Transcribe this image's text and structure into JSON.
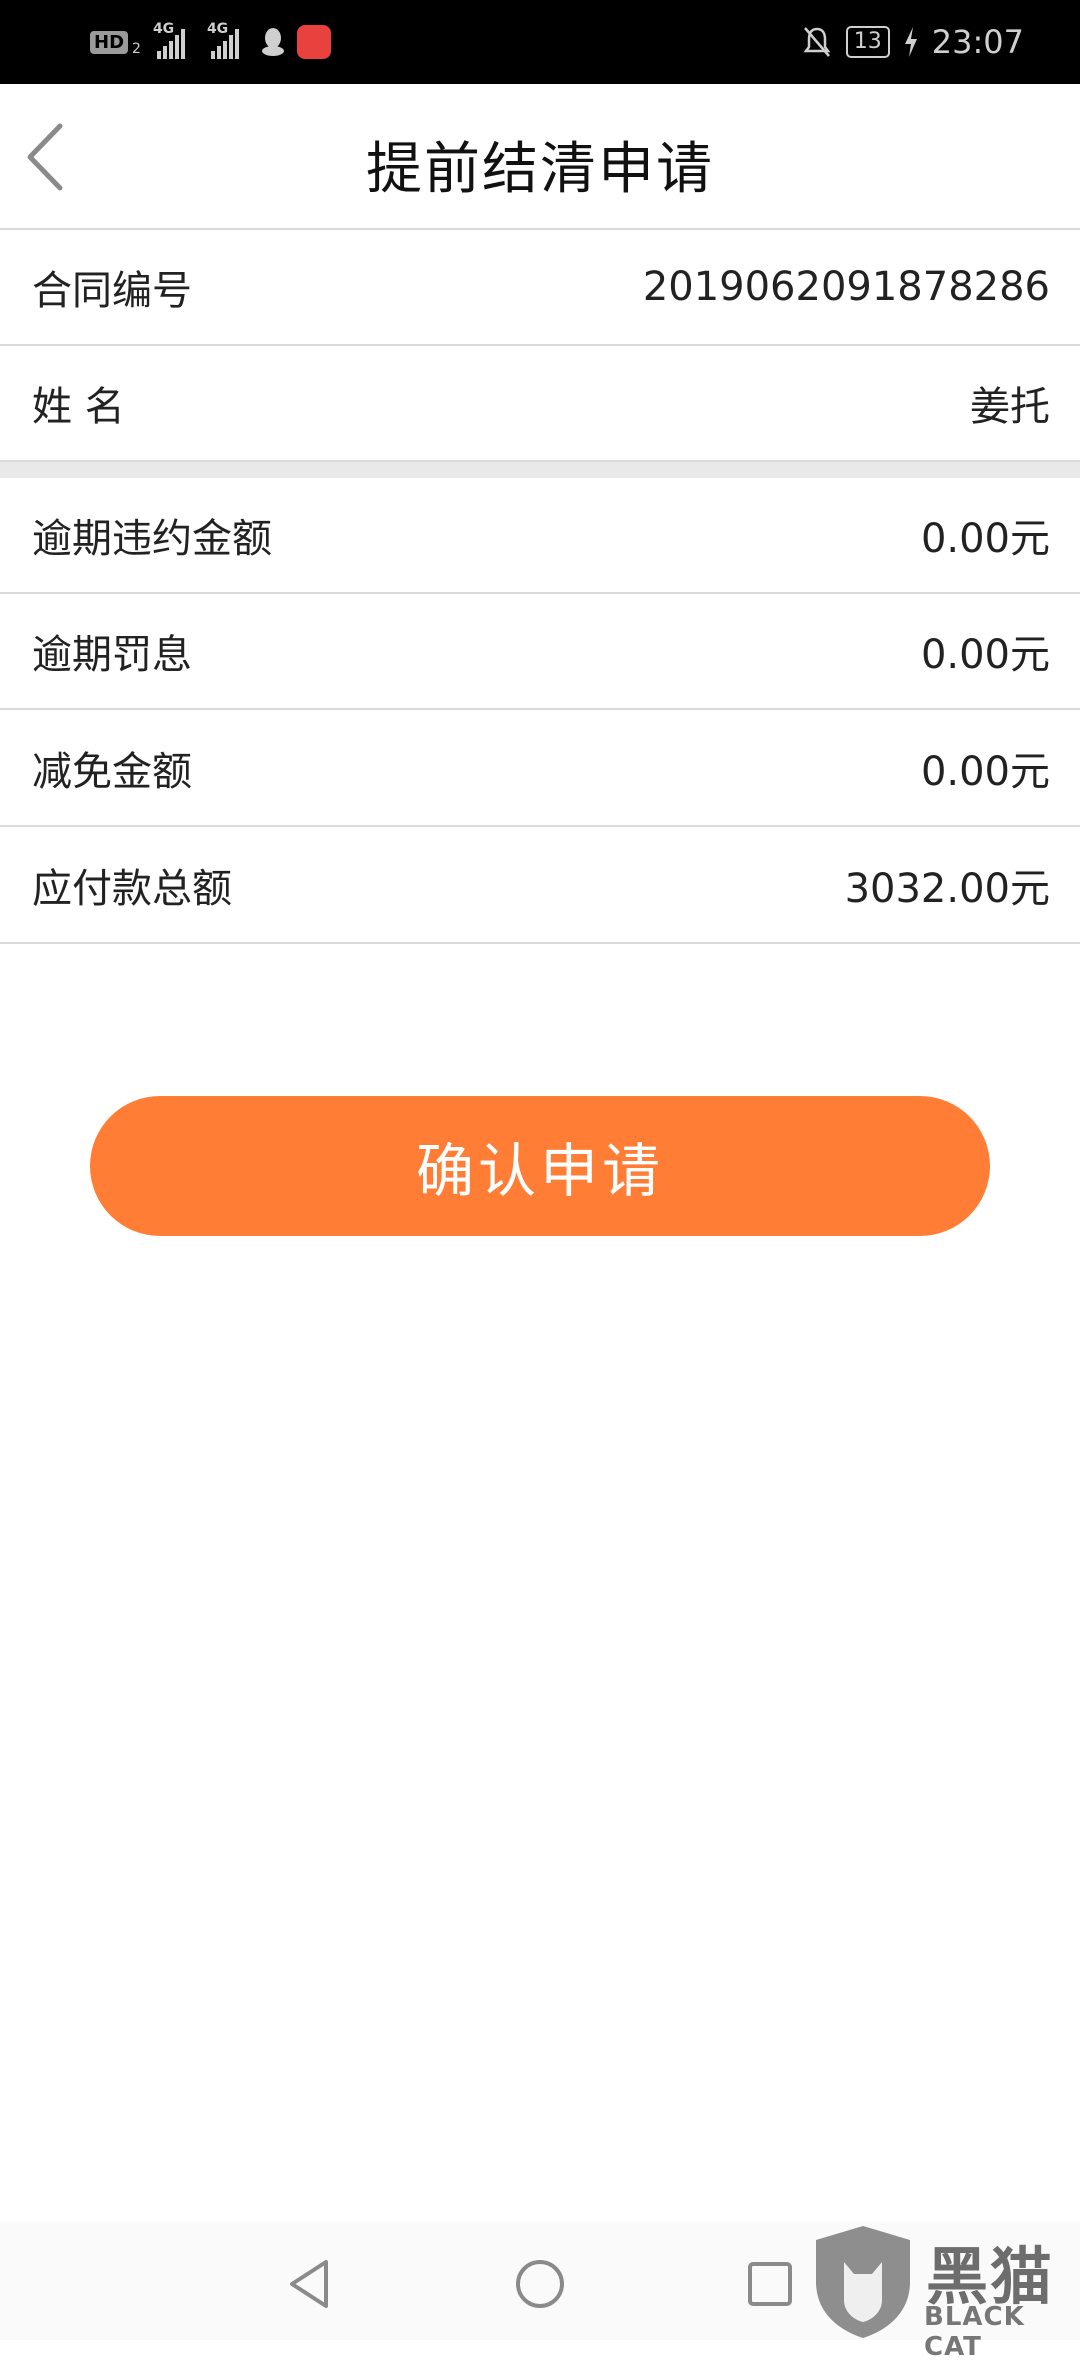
{
  "status_bar": {
    "hd_label": "HD",
    "hd_sub": "2",
    "sim1_label": "4G",
    "sim2_label": "4G",
    "battery": "13",
    "time": "23:07"
  },
  "header": {
    "title": "提前结清申请"
  },
  "contract": {
    "rows": [
      {
        "label": "合同编号",
        "value": "2019062091878286"
      },
      {
        "label": "姓 名",
        "value": "姜托"
      }
    ]
  },
  "amounts": {
    "rows": [
      {
        "label": "逾期违约金额",
        "value": "0.00元"
      },
      {
        "label": "逾期罚息",
        "value": "0.00元"
      },
      {
        "label": "减免金额",
        "value": "0.00元"
      },
      {
        "label": "应付款总额",
        "value": "3032.00元"
      }
    ]
  },
  "confirm_button": "确认申请",
  "watermark": {
    "text": "黑猫",
    "sub": "BLACK CAT"
  },
  "colors": {
    "accent": "#ff7d35",
    "status_bar_bg": "#000000",
    "divider": "#dadada"
  },
  "icons": [
    "back-chevron-icon",
    "qq-icon",
    "huawei-appgallery-icon",
    "mute-bell-icon",
    "charging-icon",
    "nav-back-icon",
    "nav-home-icon",
    "nav-recents-icon"
  ]
}
